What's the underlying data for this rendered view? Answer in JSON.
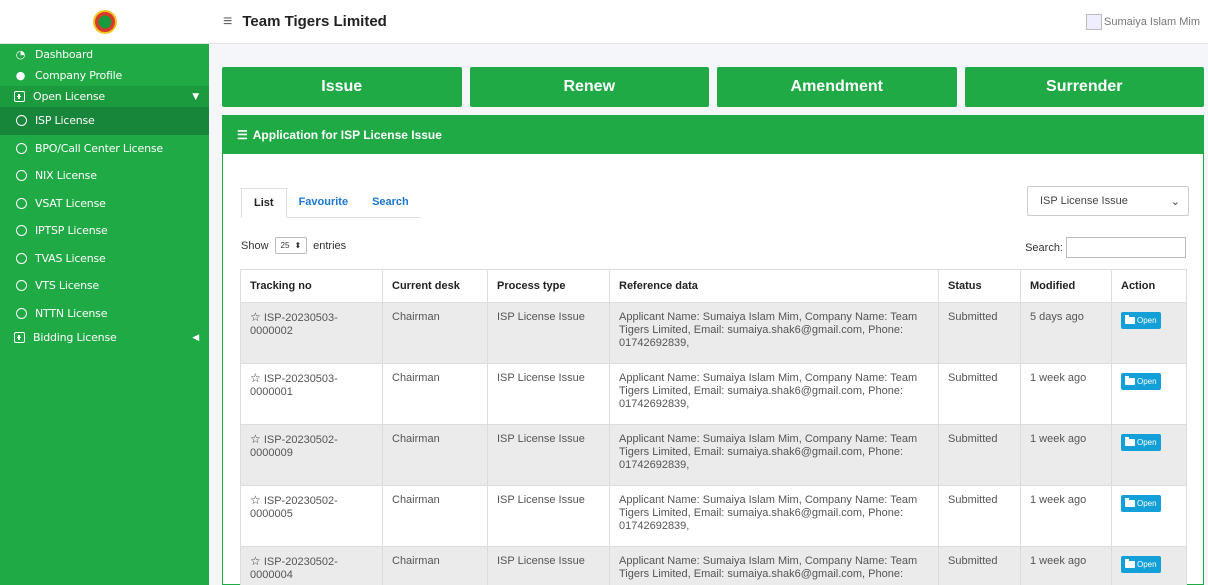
{
  "header": {
    "title": "Team Tigers Limited",
    "user_name": "Sumaiya Islam Mim"
  },
  "sidebar": {
    "items": [
      {
        "label": "Dashboard",
        "icon": "dashboard-icon"
      },
      {
        "label": "Company Profile",
        "icon": "user-icon"
      },
      {
        "label": "Open License",
        "icon": "plus-square-icon"
      },
      {
        "label": "ISP License",
        "icon": "circle-icon"
      },
      {
        "label": "BPO/Call Center License",
        "icon": "circle-icon"
      },
      {
        "label": "NIX License",
        "icon": "circle-icon"
      },
      {
        "label": "VSAT License",
        "icon": "circle-icon"
      },
      {
        "label": "IPTSP License",
        "icon": "circle-icon"
      },
      {
        "label": "TVAS License",
        "icon": "circle-icon"
      },
      {
        "label": "VTS License",
        "icon": "circle-icon"
      },
      {
        "label": "NTTN License",
        "icon": "circle-icon"
      },
      {
        "label": "Bidding License",
        "icon": "plus-square-icon"
      }
    ]
  },
  "actions": {
    "issue": "Issue",
    "renew": "Renew",
    "amendment": "Amendment",
    "surrender": "Surrender"
  },
  "panel": {
    "title": "Application for ISP License Issue",
    "tabs": [
      "List",
      "Favourite",
      "Search"
    ],
    "filter_value": "ISP License Issue",
    "show_label": "Show",
    "entries_value": "25",
    "entries_label": "entries",
    "search_label": "Search:"
  },
  "table": {
    "headers": [
      "Tracking no",
      "Current desk",
      "Process type",
      "Reference data",
      "Status",
      "Modified",
      "Action"
    ],
    "rows": [
      {
        "tracking": "ISP-20230503-0000002",
        "desk": "Chairman",
        "process": "ISP License Issue",
        "reference": "Applicant Name: Sumaiya Islam Mim, Company Name: Team Tigers Limited, Email: sumaiya.shak6@gmail.com, Phone: 01742692839,",
        "status": "Submitted",
        "modified": "5 days ago",
        "action": "Open"
      },
      {
        "tracking": "ISP-20230503-0000001",
        "desk": "Chairman",
        "process": "ISP License Issue",
        "reference": "Applicant Name: Sumaiya Islam Mim, Company Name: Team Tigers Limited, Email: sumaiya.shak6@gmail.com, Phone: 01742692839,",
        "status": "Submitted",
        "modified": "1 week ago",
        "action": "Open"
      },
      {
        "tracking": "ISP-20230502-0000009",
        "desk": "Chairman",
        "process": "ISP License Issue",
        "reference": "Applicant Name: Sumaiya Islam Mim, Company Name: Team Tigers Limited, Email: sumaiya.shak6@gmail.com, Phone: 01742692839,",
        "status": "Submitted",
        "modified": "1 week ago",
        "action": "Open"
      },
      {
        "tracking": "ISP-20230502-0000005",
        "desk": "Chairman",
        "process": "ISP License Issue",
        "reference": "Applicant Name: Sumaiya Islam Mim, Company Name: Team Tigers Limited, Email: sumaiya.shak6@gmail.com, Phone: 01742692839,",
        "status": "Submitted",
        "modified": "1 week ago",
        "action": "Open"
      },
      {
        "tracking": "ISP-20230502-0000004",
        "desk": "Chairman",
        "process": "ISP License Issue",
        "reference": "Applicant Name: Sumaiya Islam Mim, Company Name: Team Tigers Limited, Email: sumaiya.shak6@gmail.com, Phone:",
        "status": "Submitted",
        "modified": "1 week ago",
        "action": "Open"
      }
    ]
  }
}
